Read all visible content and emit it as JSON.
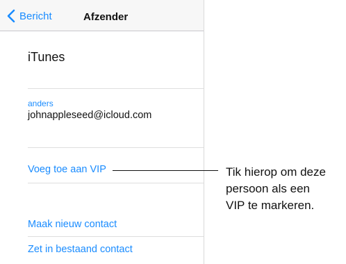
{
  "navbar": {
    "back_label": "Bericht",
    "title": "Afzender",
    "back_icon": "chevron-left-icon"
  },
  "sender": {
    "name": "iTunes",
    "email_label": "anders",
    "email": "johnappleseed@icloud.com"
  },
  "actions": {
    "add_vip": "Voeg toe aan VIP",
    "new_contact": "Maak nieuw contact",
    "existing_contact": "Zet in bestaand contact"
  },
  "callout": {
    "lines": [
      "Tik hierop om deze",
      "persoon als een",
      "VIP te markeren."
    ]
  },
  "colors": {
    "accent": "#1a8cff",
    "text": "#111111",
    "separator": "#dedede",
    "navbar_bg": "#f7f7f7"
  }
}
